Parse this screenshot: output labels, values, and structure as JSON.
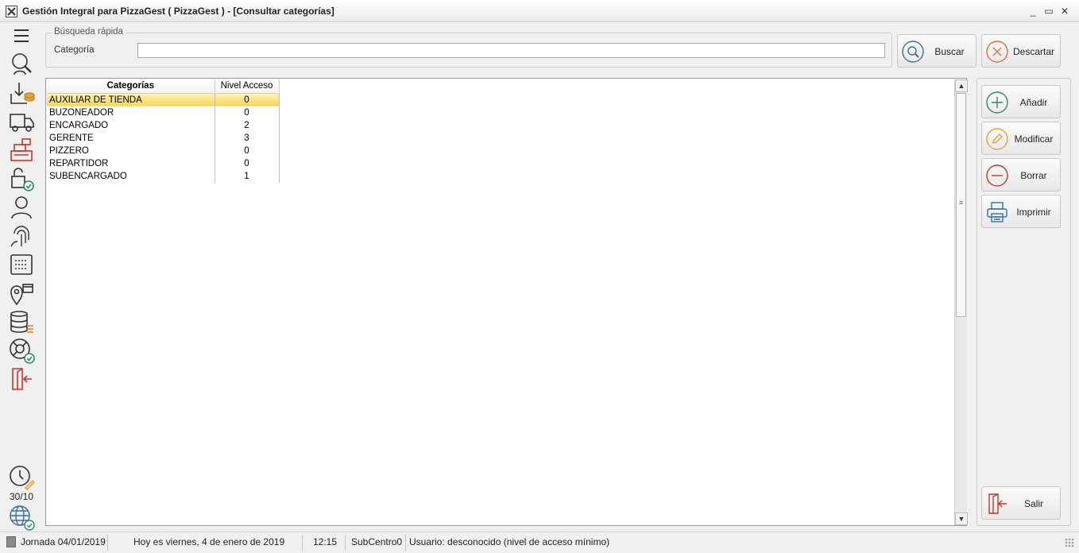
{
  "window": {
    "title": "Gestión Integral para PizzaGest ( PizzaGest ) - [Consultar categorías]",
    "controls": {
      "minimize": "_",
      "restore": "▭",
      "close": "✕"
    }
  },
  "nav": {
    "icons": [
      "menu-icon",
      "search-client-icon",
      "stock-download-icon",
      "delivery-truck-icon",
      "cash-register-icon",
      "lock-check-icon",
      "user-icon",
      "fingerprint-icon",
      "keyboard-icon",
      "location-store-icon",
      "database-list-icon",
      "lifebuoy-check-icon",
      "exit-door-icon"
    ],
    "counter": "30/10",
    "bottom_icons": [
      "clock-edit-icon",
      "globe-check-icon"
    ]
  },
  "search": {
    "legend": "Búsqueda rápida",
    "label": "Categoría",
    "value": "",
    "buscar_label": "Buscar",
    "descartar_label": "Descartar"
  },
  "grid": {
    "columns": [
      "Categorías",
      "Nivel Acceso"
    ],
    "rows": [
      {
        "categoria": "AUXILIAR DE TIENDA",
        "nivel": "0"
      },
      {
        "categoria": "BUZONEADOR",
        "nivel": "0"
      },
      {
        "categoria": "ENCARGADO",
        "nivel": "2"
      },
      {
        "categoria": "GERENTE",
        "nivel": "3"
      },
      {
        "categoria": "PIZZERO",
        "nivel": "0"
      },
      {
        "categoria": "REPARTIDOR",
        "nivel": "0"
      },
      {
        "categoria": "SUBENCARGADO",
        "nivel": "1"
      }
    ],
    "scroll": {
      "up": "▲",
      "down": "▼",
      "grip": "≡"
    }
  },
  "actions": {
    "anadir": "Añadir",
    "modificar": "Modificar",
    "borrar": "Borrar",
    "imprimir": "Imprimir",
    "salir": "Salir"
  },
  "status": {
    "jornada": "Jornada 04/01/2019",
    "fecha": "Hoy es viernes, 4 de enero de 2019",
    "hora": "12:15",
    "subcentro": "SubCentro0",
    "usuario": "Usuario: desconocido (nivel de acceso mínimo)"
  },
  "colors": {
    "accent_red": "#c0392b",
    "accent_green": "#2e8b57",
    "accent_blue": "#3a6ea5",
    "accent_orange": "#e8a33c",
    "selection": "#f8d45a"
  }
}
